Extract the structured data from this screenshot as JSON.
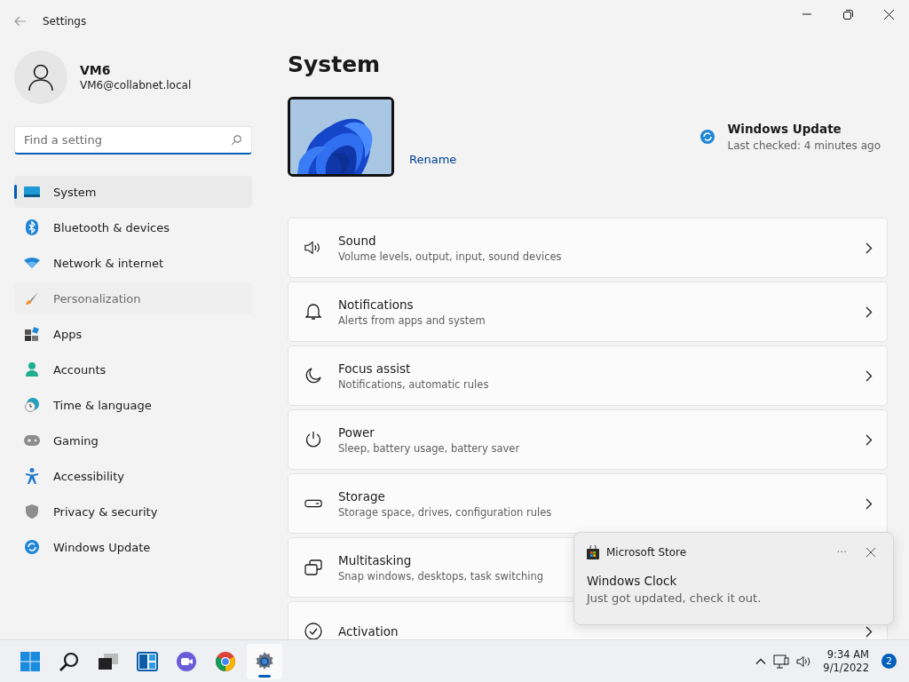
{
  "window": {
    "title": "Settings"
  },
  "profile": {
    "name": "VM6",
    "email": "VM6@collabnet.local"
  },
  "search": {
    "placeholder": "Find a setting"
  },
  "nav": [
    {
      "label": "System",
      "selected": true,
      "hovered": false
    },
    {
      "label": "Bluetooth & devices",
      "selected": false,
      "hovered": false
    },
    {
      "label": "Network & internet",
      "selected": false,
      "hovered": false
    },
    {
      "label": "Personalization",
      "selected": false,
      "hovered": true
    },
    {
      "label": "Apps",
      "selected": false,
      "hovered": false
    },
    {
      "label": "Accounts",
      "selected": false,
      "hovered": false
    },
    {
      "label": "Time & language",
      "selected": false,
      "hovered": false
    },
    {
      "label": "Gaming",
      "selected": false,
      "hovered": false
    },
    {
      "label": "Accessibility",
      "selected": false,
      "hovered": false
    },
    {
      "label": "Privacy & security",
      "selected": false,
      "hovered": false
    },
    {
      "label": "Windows Update",
      "selected": false,
      "hovered": false
    }
  ],
  "page": {
    "title": "System"
  },
  "device": {
    "rename": "Rename"
  },
  "update": {
    "title": "Windows Update",
    "status": "Last checked: 4 minutes ago"
  },
  "settings": [
    {
      "title": "Sound",
      "subtitle": "Volume levels, output, input, sound devices"
    },
    {
      "title": "Notifications",
      "subtitle": "Alerts from apps and system"
    },
    {
      "title": "Focus assist",
      "subtitle": "Notifications, automatic rules"
    },
    {
      "title": "Power",
      "subtitle": "Sleep, battery usage, battery saver"
    },
    {
      "title": "Storage",
      "subtitle": "Storage space, drives, configuration rules"
    },
    {
      "title": "Multitasking",
      "subtitle": "Snap windows, desktops, task switching"
    },
    {
      "title": "Activation"
    }
  ],
  "toast": {
    "app": "Microsoft Store",
    "more": "···",
    "title": "Windows Clock",
    "body": "Just got updated, check it out."
  },
  "taskbar": {
    "apps": [
      {
        "active": false
      },
      {
        "active": false
      },
      {
        "active": false
      },
      {
        "active": false
      },
      {
        "active": false
      },
      {
        "active": false
      },
      {
        "active": true
      }
    ],
    "time": "9:34 AM",
    "date": "9/1/2022",
    "badge": "2"
  }
}
